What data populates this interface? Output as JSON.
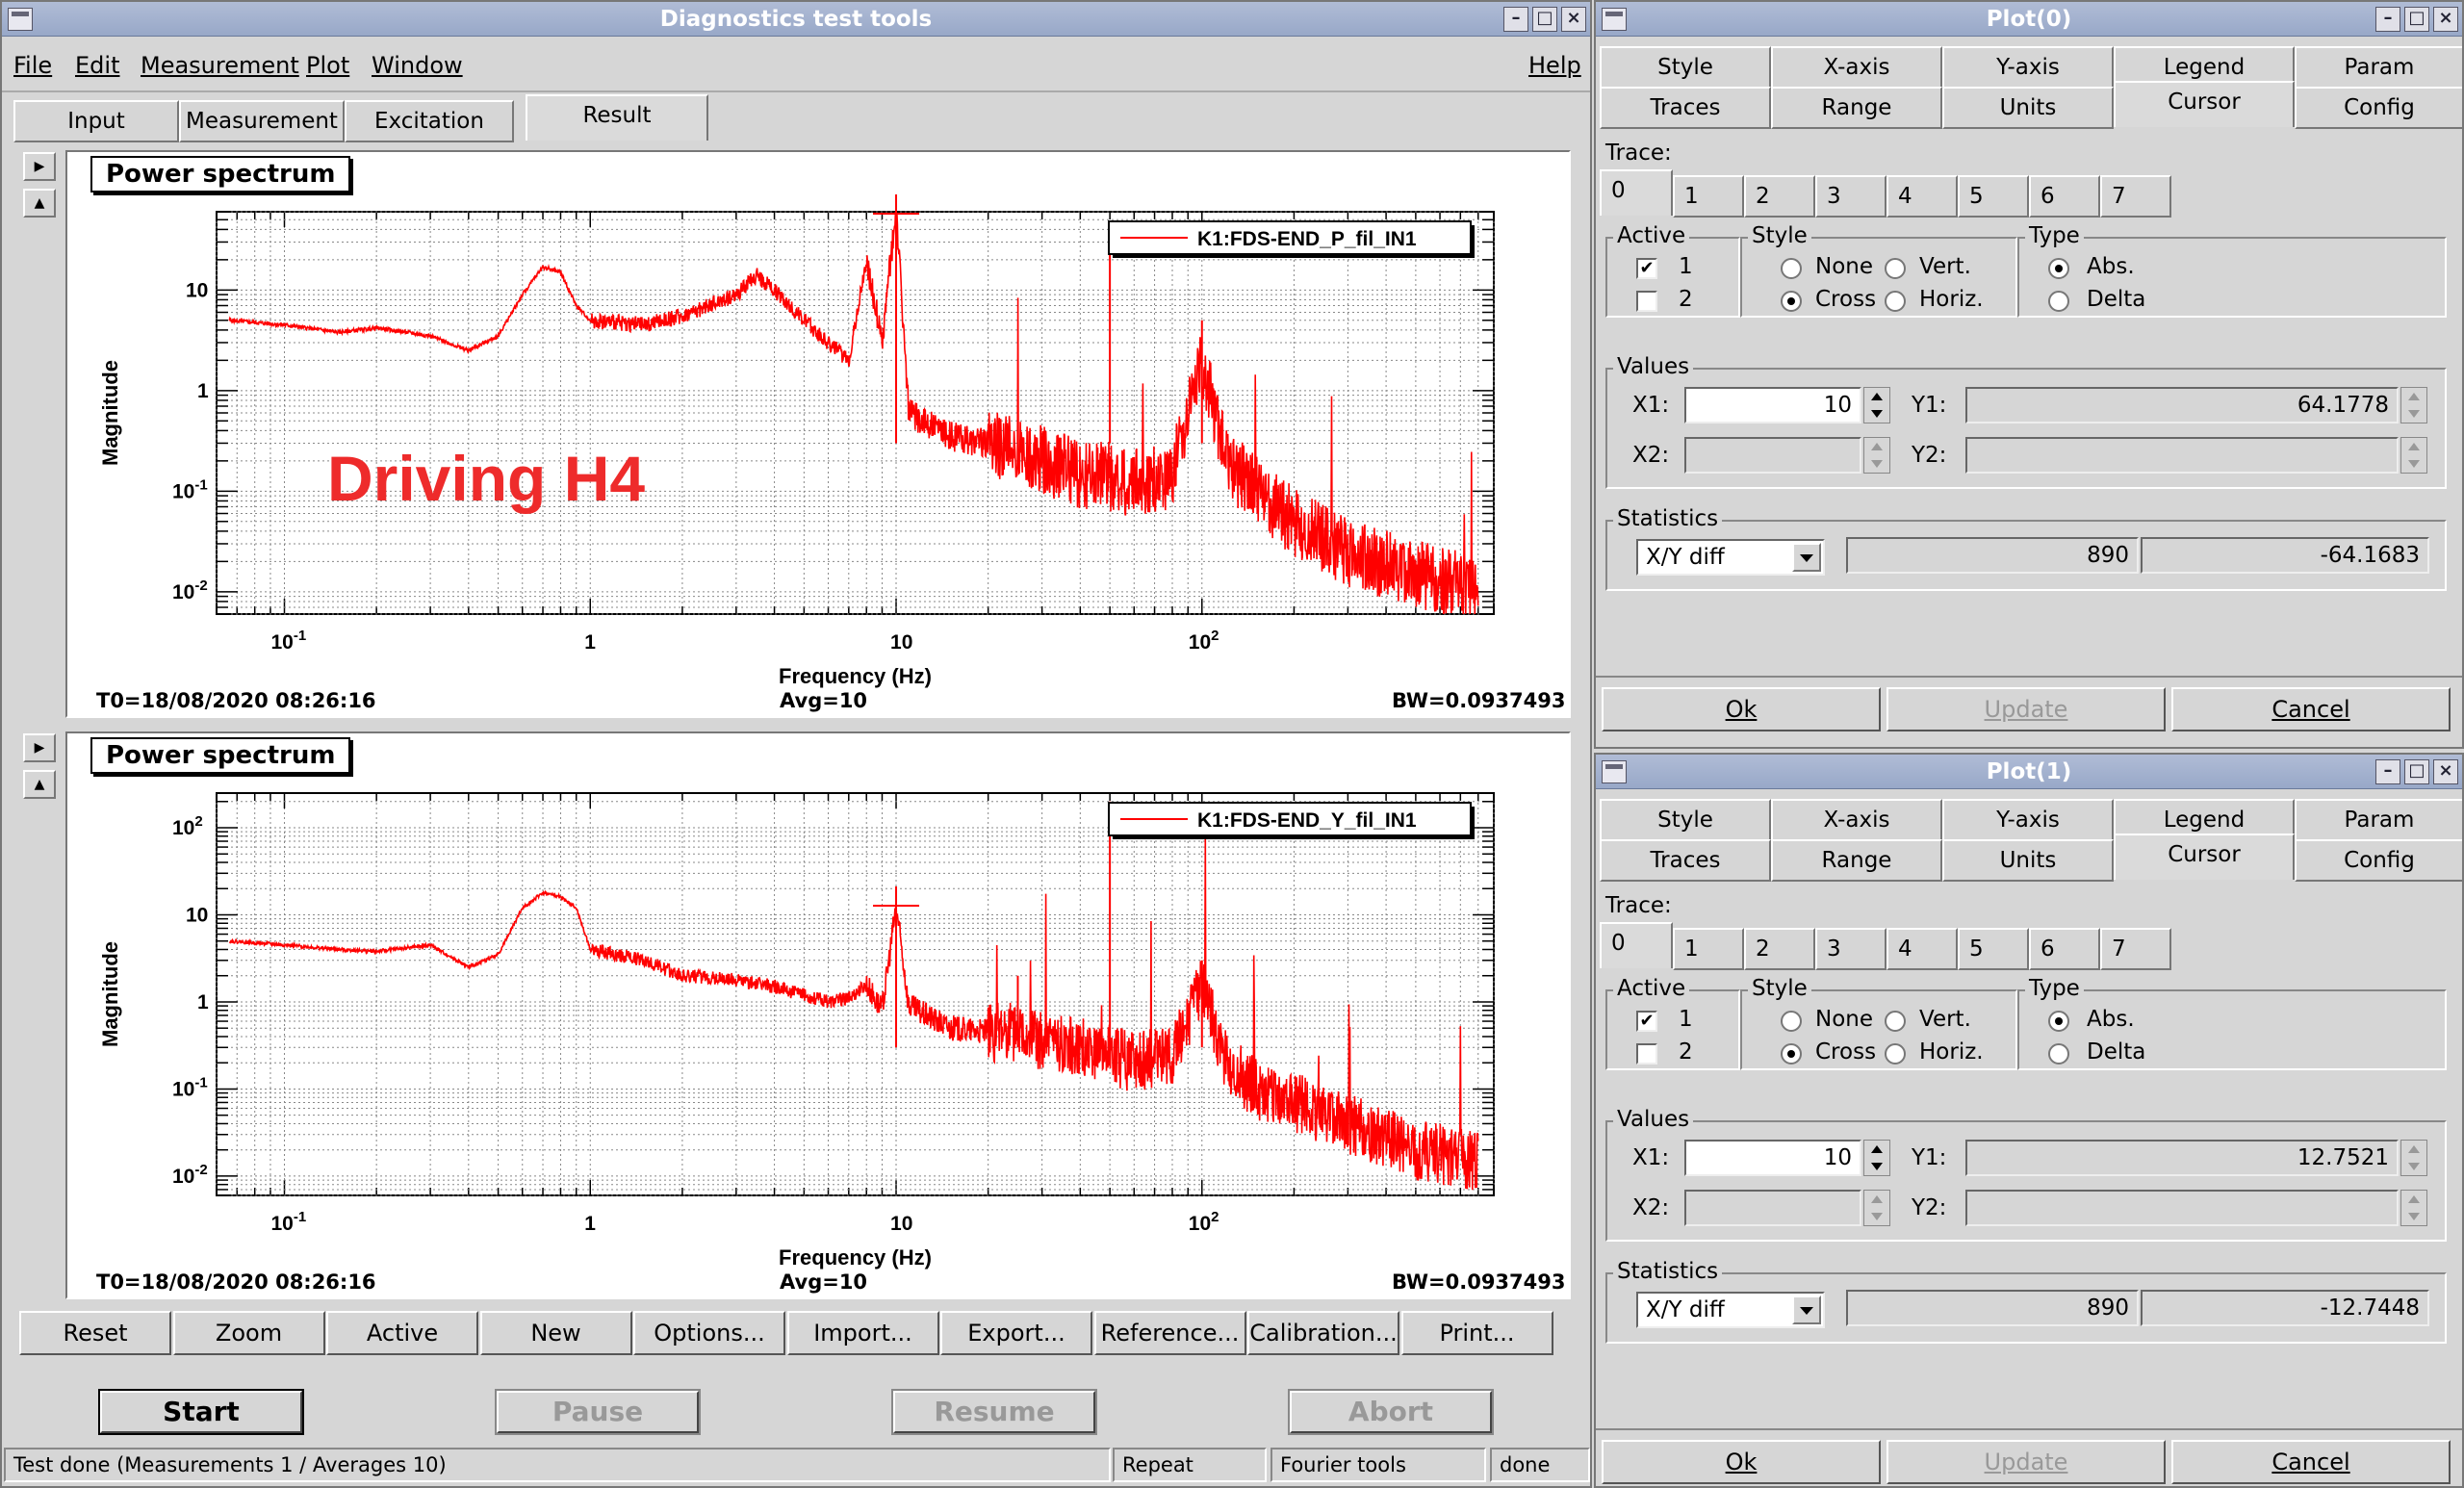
{
  "main": {
    "title": "Diagnostics test tools",
    "menu": [
      "File",
      "Edit",
      "Measurement",
      "Plot",
      "Window",
      "Help"
    ],
    "tabs": [
      "Input",
      "Measurement",
      "Excitation",
      "Result"
    ],
    "panels": [
      {
        "title": "Power spectrum",
        "legend": "K1:FDS-END_P_fil_IN1",
        "annotation": "Driving H4",
        "t0": "T0=18/08/2020 08:26:16",
        "avg": "Avg=10",
        "bw": "BW=0.0937493",
        "xlabel": "Frequency (Hz)",
        "ylabel": "Magnitude"
      },
      {
        "title": "Power spectrum",
        "legend": "K1:FDS-END_Y_fil_IN1",
        "annotation": "",
        "t0": "T0=18/08/2020 08:26:16",
        "avg": "Avg=10",
        "bw": "BW=0.0937493",
        "xlabel": "Frequency (Hz)",
        "ylabel": "Magnitude"
      }
    ],
    "buttons": [
      "Reset",
      "Zoom",
      "Active",
      "New",
      "Options...",
      "Import...",
      "Export...",
      "Reference...",
      "Calibration...",
      "Print..."
    ],
    "run_buttons": [
      "Start",
      "Pause",
      "Resume",
      "Abort"
    ],
    "status": {
      "message": "Test done (Measurements 1 / Averages 10)",
      "repeat": "Repeat",
      "fourier": "Fourier tools",
      "state": "done"
    }
  },
  "plotwins": [
    {
      "title": "Plot(0)",
      "x1": "10",
      "y1": "64.1778",
      "stat_mode": "X/Y diff",
      "stat_x": "890",
      "stat_y": "-64.1683"
    },
    {
      "title": "Plot(1)",
      "x1": "10",
      "y1": "12.7521",
      "stat_mode": "X/Y diff",
      "stat_x": "890",
      "stat_y": "-12.7448"
    }
  ],
  "plotwin_common": {
    "tabs_row1": [
      "Style",
      "X-axis",
      "Y-axis",
      "Legend",
      "Param"
    ],
    "tabs_row2": [
      "Traces",
      "Range",
      "Units",
      "Cursor",
      "Config"
    ],
    "trace_label": "Trace:",
    "traces": [
      "0",
      "1",
      "2",
      "3",
      "4",
      "5",
      "6",
      "7"
    ],
    "active_label": "Active",
    "active_items": [
      "1",
      "2"
    ],
    "style_label": "Style",
    "style_items": [
      "None",
      "Vert.",
      "Cross",
      "Horiz."
    ],
    "type_label": "Type",
    "type_items": [
      "Abs.",
      "Delta"
    ],
    "values_label": "Values",
    "x1_label": "X1:",
    "x2_label": "X2:",
    "y1_label": "Y1:",
    "y2_label": "Y2:",
    "statistics_label": "Statistics",
    "ok": "Ok",
    "update": "Update",
    "cancel": "Cancel"
  },
  "colors": {
    "trace": "#ff0000",
    "titlebar": "#a4b2d0"
  },
  "chart_data": [
    {
      "type": "line",
      "title": "Power spectrum",
      "xscale": "log",
      "yscale": "log",
      "xlim": [
        0.06,
        900
      ],
      "ylim": [
        0.006,
        60
      ],
      "xticks": [
        "10^-1",
        "1",
        "10",
        "10^2"
      ],
      "yticks": [
        "10^-2",
        "10^-1",
        "1",
        "10"
      ],
      "xlabel": "Frequency (Hz)",
      "ylabel": "Magnitude",
      "series": [
        {
          "name": "K1:FDS-END_P_fil_IN1",
          "x": [
            0.066,
            0.1,
            0.15,
            0.2,
            0.3,
            0.4,
            0.5,
            0.6,
            0.7,
            0.8,
            0.9,
            1,
            1.5,
            2,
            3,
            3.5,
            4,
            5,
            6,
            7,
            8,
            9,
            10,
            11,
            15,
            20,
            25,
            30,
            40,
            50,
            60,
            80,
            100,
            120,
            150,
            200,
            300,
            500,
            800
          ],
          "y": [
            5,
            4.5,
            3.8,
            4.2,
            3.5,
            2.5,
            3.5,
            9,
            17,
            15,
            7,
            5,
            4.5,
            5.5,
            9,
            14,
            10,
            5,
            3,
            2,
            20,
            3,
            64,
            0.6,
            0.35,
            0.3,
            0.25,
            0.2,
            0.15,
            0.14,
            0.12,
            0.15,
            2,
            0.2,
            0.1,
            0.05,
            0.025,
            0.015,
            0.01
          ]
        }
      ]
    },
    {
      "type": "line",
      "title": "Power spectrum",
      "xscale": "log",
      "yscale": "log",
      "xlim": [
        0.06,
        900
      ],
      "ylim": [
        0.006,
        250
      ],
      "xticks": [
        "10^-1",
        "1",
        "10",
        "10^2"
      ],
      "yticks": [
        "10^-2",
        "10^-1",
        "1",
        "10",
        "10^2"
      ],
      "xlabel": "Frequency (Hz)",
      "ylabel": "Magnitude",
      "series": [
        {
          "name": "K1:FDS-END_Y_fil_IN1",
          "x": [
            0.066,
            0.1,
            0.15,
            0.2,
            0.3,
            0.4,
            0.5,
            0.6,
            0.7,
            0.8,
            0.9,
            1,
            1.5,
            2,
            3,
            4,
            5,
            6,
            7,
            8,
            9,
            10,
            11,
            15,
            20,
            25,
            30,
            40,
            50,
            60,
            80,
            100,
            120,
            150,
            200,
            300,
            500,
            800
          ],
          "y": [
            5,
            4.5,
            4,
            3.8,
            4.5,
            2.5,
            3.5,
            12,
            18,
            16,
            12,
            4,
            3,
            2,
            1.8,
            1.5,
            1.2,
            1,
            1.1,
            1.6,
            0.8,
            12.75,
            0.9,
            0.5,
            0.45,
            0.45,
            0.35,
            0.3,
            0.25,
            0.2,
            0.25,
            1.5,
            0.2,
            0.1,
            0.07,
            0.04,
            0.02,
            0.015
          ]
        }
      ]
    }
  ]
}
